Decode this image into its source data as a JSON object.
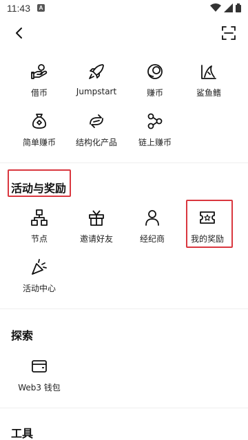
{
  "status": {
    "time": "11:43",
    "a_badge": "A"
  },
  "finance": [
    {
      "label": "借币",
      "icon": "hand-coin-icon"
    },
    {
      "label": "Jumpstart",
      "icon": "rocket-icon"
    },
    {
      "label": "赚币",
      "icon": "coin-stack-icon"
    },
    {
      "label": "鲨鱼鳍",
      "icon": "shark-fin-icon"
    },
    {
      "label": "简单赚币",
      "icon": "money-bag-icon"
    },
    {
      "label": "结构化产品",
      "icon": "structured-icon"
    },
    {
      "label": "链上赚币",
      "icon": "chain-node-icon"
    }
  ],
  "activities": {
    "title": "活动与奖励",
    "items": [
      {
        "label": "节点",
        "icon": "node-tree-icon"
      },
      {
        "label": "邀请好友",
        "icon": "gift-icon"
      },
      {
        "label": "经纪商",
        "icon": "person-icon"
      },
      {
        "label": "我的奖励",
        "icon": "ticket-icon"
      },
      {
        "label": "活动中心",
        "icon": "party-popper-icon"
      }
    ]
  },
  "explore": {
    "title": "探索",
    "items": [
      {
        "label": "Web3 钱包",
        "icon": "wallet-icon"
      }
    ]
  },
  "tools": {
    "title": "工具"
  },
  "colors": {
    "highlight": "#d9363e"
  }
}
